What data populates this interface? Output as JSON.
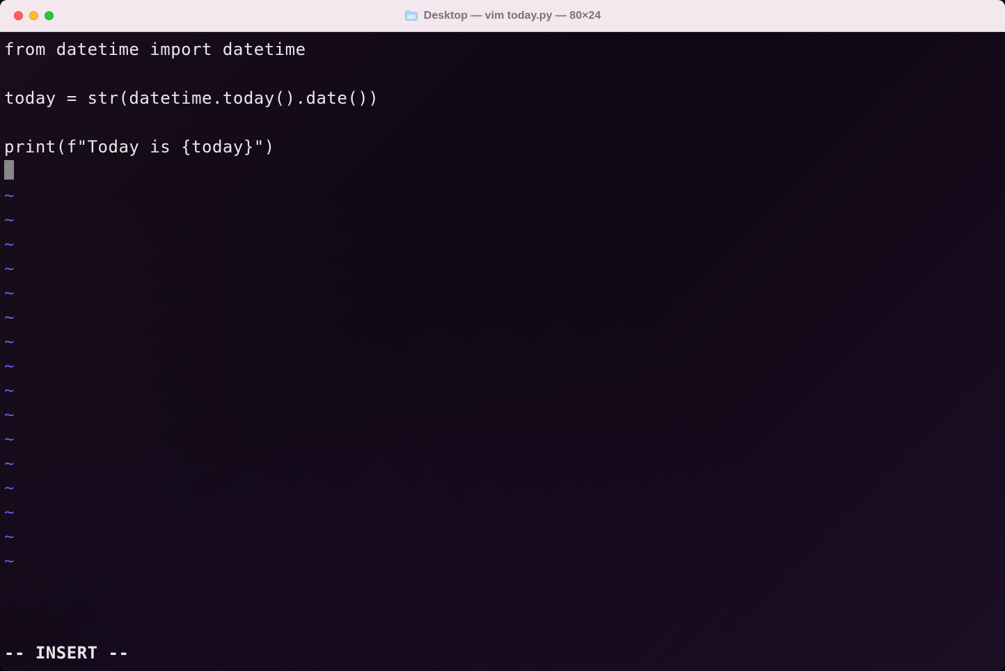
{
  "window": {
    "title": "Desktop — vim today.py — 80×24"
  },
  "editor": {
    "lines": [
      "from datetime import datetime",
      "",
      "today = str(datetime.today().date())",
      "",
      "print(f\"Today is {today}\")"
    ],
    "tilde": "~",
    "tilde_count": 16,
    "status_line": "-- INSERT --"
  }
}
